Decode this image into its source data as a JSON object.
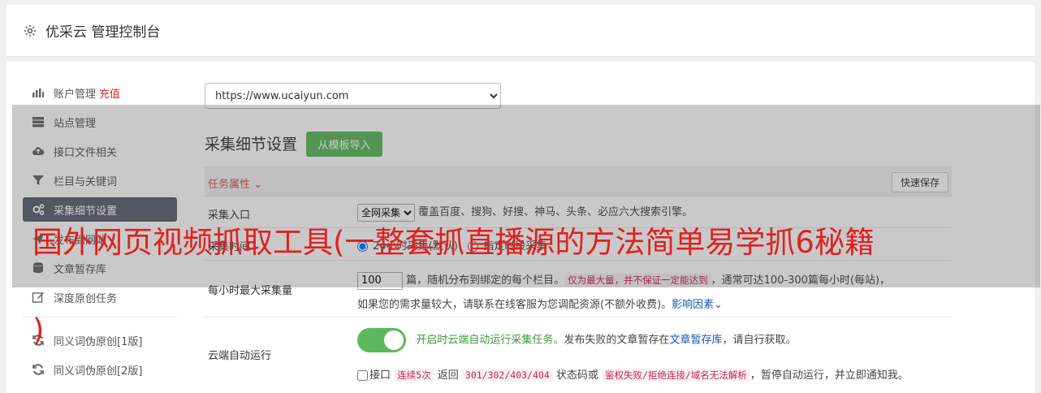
{
  "header": {
    "brand": "优采云 管理控制台",
    "icon": "gear-icon"
  },
  "sidebar": {
    "items": [
      {
        "label": "账户管理",
        "badge": "充值",
        "icon": "bar-chart-icon"
      },
      {
        "label": "站点管理",
        "icon": "server-icon"
      },
      {
        "label": "接口文件相关",
        "icon": "cloud-upload-icon"
      },
      {
        "label": "栏目与关键词",
        "icon": "filter-icon"
      },
      {
        "label": "采集细节设置",
        "icon": "gears-icon",
        "active": true
      },
      {
        "label": "发布到网站",
        "icon": "send-icon"
      },
      {
        "label": "文章暂存库",
        "icon": "database-icon"
      },
      {
        "label": "深度原创任务",
        "icon": "edit-icon"
      },
      {
        "label": "同义词伪原创[1版]",
        "icon": "refresh-icon"
      },
      {
        "label": "同义词伪原创[2版]",
        "icon": "refresh-icon"
      }
    ]
  },
  "site_select": {
    "value": "https://www.ucaiyun.com"
  },
  "section": {
    "title": "采集细节设置",
    "template_button": "从模板导入",
    "attr_label": "任务属性",
    "quick_save": "快速保存"
  },
  "rows": {
    "entry": {
      "label": "采集入口",
      "select_value": "全网采集",
      "desc": "覆盖百度、搜狗、好搜、神马、头条、必应六大搜索引擎。"
    },
    "mode": {
      "label": "采集时间",
      "radio1": "24小时采集(默认)",
      "radio2": "指定时段采集"
    },
    "max": {
      "label": "每小时最大采集量",
      "value": "100",
      "text1": "篇，随机分布到绑定的每个栏目。",
      "code1": "仅为最大量，并不保证一定能达到",
      "text2": "，通常可达100-300篇每小时(每站)，",
      "line2": "如果您的需求量较大，请联系在线客服为您调配资源(不额外收费)。",
      "link": "影响因素"
    },
    "cloud": {
      "label": "云端自动运行",
      "green": "开启时云端自动运行采集任务。",
      "text1": "发布失败的文章暂存在",
      "link": "文章暂存库",
      "text2": "，请自行获取。",
      "cb_label": "接口",
      "code1": "连续5次",
      "text3": "返回",
      "code2": "301/302/403/404",
      "text4": "状态码或",
      "code3": "鉴权失败/拒绝连接/域名无法解析",
      "text5": "，暂停自动运行，并立即通知我。"
    }
  },
  "banner": {
    "line1": "国外网页视频抓取工具(一整套抓直播源的方法简单易学抓6秘籍",
    "line2": ")"
  },
  "colors": {
    "accent_green": "#5cb85c",
    "active_nav": "#5a6270",
    "red": "#e02020"
  }
}
